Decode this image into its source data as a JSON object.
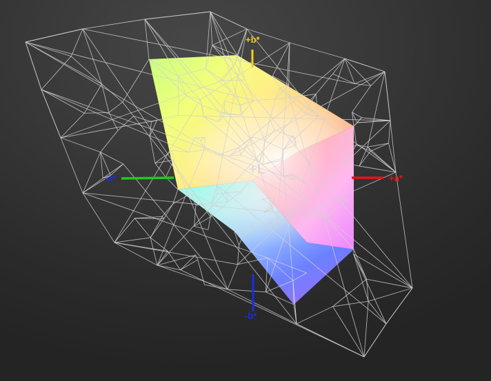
{
  "viewer": {
    "background": "#3a3a3a",
    "mesh_color": "#d2d2d2",
    "solid_gamut": {
      "top_face": [
        "#c8ff80",
        "#ffff70",
        "#ffcc66",
        "#ffefc2",
        "#fff8e8"
      ],
      "right_face": [
        "#ff8a80",
        "#ffb3d0",
        "#ff9cff"
      ],
      "bottom_face": [
        "#8cffe0",
        "#9ec8ff",
        "#6080ff",
        "#c080ff"
      ]
    }
  },
  "axes": {
    "plus_b": {
      "label": "+b*",
      "color": "#f0d020"
    },
    "minus_b": {
      "label": "-b*",
      "color": "#1a2ee0"
    },
    "plus_a": {
      "label": "+a*",
      "color": "#e01818"
    },
    "minus_a": {
      "label": "-a*",
      "color": "#22c81e",
      "label_color": "#1a2ee0"
    },
    "center": {
      "label": "+L",
      "color": "#d8d8d8"
    }
  }
}
